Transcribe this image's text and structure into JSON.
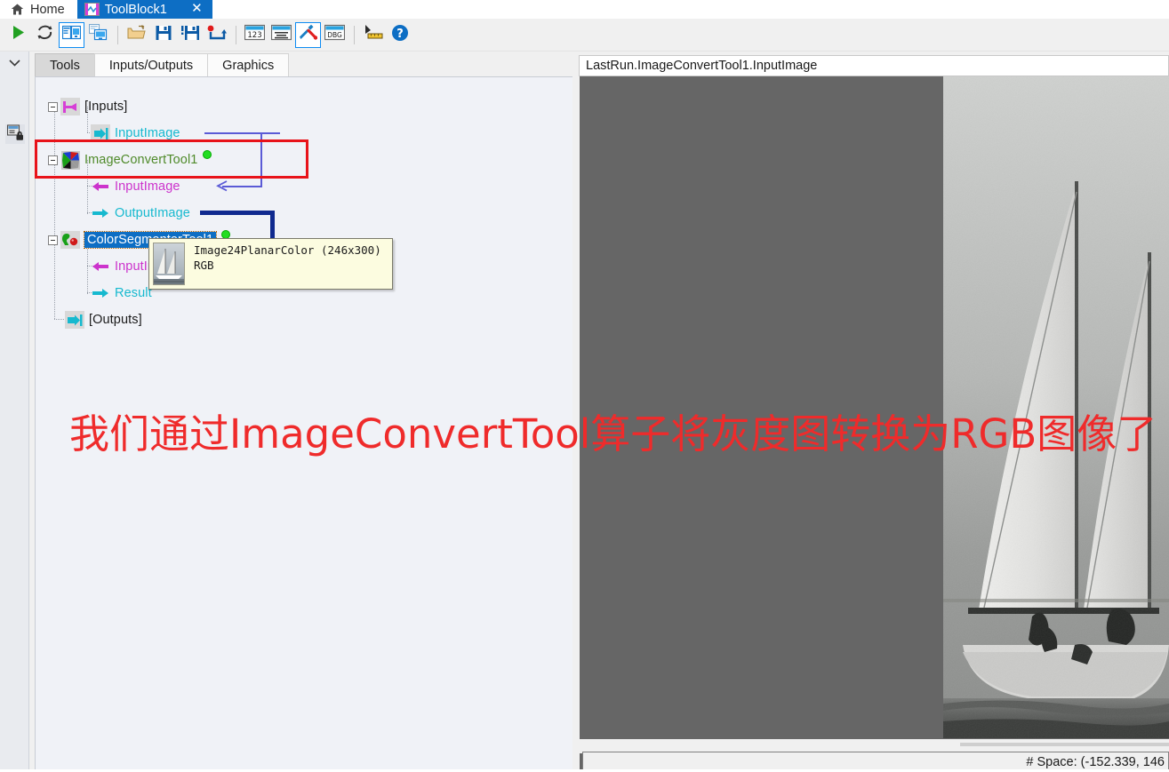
{
  "window": {
    "home_tab_label": "Home",
    "home_icon": "home-icon",
    "document_tab_label": "ToolBlock1",
    "document_tab_icon": "toolblock-icon",
    "close_label": "✕"
  },
  "toolbar": {
    "buttons": [
      {
        "name": "run-button",
        "icon": "play-triangle-icon",
        "label": "Run",
        "active": false
      },
      {
        "name": "run-continuous-button",
        "icon": "loop-arrows-icon",
        "label": "Run Continuous",
        "active": false
      },
      {
        "name": "show-tool-panel-button",
        "icon": "dual-pane-icon",
        "label": "Show Tool Panel",
        "active": true
      },
      {
        "name": "show-result-panel-button",
        "icon": "stacked-pane-icon",
        "label": "Show Result Panel",
        "active": false
      },
      {
        "name": "open-button",
        "icon": "open-folder-icon",
        "label": "Open",
        "active": false
      },
      {
        "name": "save-button",
        "icon": "floppy-save-icon",
        "label": "Save",
        "active": false
      },
      {
        "name": "save-as-button",
        "icon": "floppy-save-as-icon",
        "label": "Save As",
        "active": false
      },
      {
        "name": "record-restore-button",
        "icon": "red-dot-arrow-icon",
        "label": "Restore",
        "active": false
      },
      {
        "name": "show-values-button",
        "icon": "numbers-123-icon",
        "label": "Show Values",
        "active": false
      },
      {
        "name": "show-details-button",
        "icon": "list-lines-icon",
        "label": "Show Details",
        "active": false
      },
      {
        "name": "tools-settings-button",
        "icon": "wrench-screwdriver-icon",
        "label": "Tools",
        "active": true
      },
      {
        "name": "debug-button",
        "icon": "dbg-icon",
        "label": "DBG",
        "active": false
      },
      {
        "name": "measure-button",
        "icon": "ruler-cursor-icon",
        "label": "Measure",
        "active": false
      },
      {
        "name": "help-button",
        "icon": "question-circle-icon",
        "label": "Help",
        "active": false
      }
    ]
  },
  "leftrail": {
    "collapse_icon": "chevron-down-icon",
    "lock_icon": "locked-panel-icon"
  },
  "panel_tabs": [
    {
      "name": "tab-tools",
      "label": "Tools",
      "selected": true
    },
    {
      "name": "tab-inputs-outputs",
      "label": "Inputs/Outputs",
      "selected": false
    },
    {
      "name": "tab-graphics",
      "label": "Graphics",
      "selected": false
    }
  ],
  "tree": {
    "nodes": [
      {
        "name": "tree-node-inputs",
        "label": "[Inputs]",
        "icon": "inputs-arrow-icon",
        "color": "black",
        "indent": 0,
        "toggle": true,
        "dot": false,
        "selected": false
      },
      {
        "name": "tree-node-inputimage-root",
        "label": "InputImage",
        "icon": "input-terminal-icon",
        "color": "cyan",
        "indent": 1,
        "toggle": false,
        "dot": false,
        "selected": false
      },
      {
        "name": "tree-node-imageconverttool1",
        "label": "ImageConvertTool1",
        "icon": "image-convert-tool-icon",
        "color": "green",
        "indent": 0,
        "toggle": true,
        "dot": true,
        "selected": false
      },
      {
        "name": "tree-node-ict-inputimage",
        "label": "InputImage",
        "icon": "input-arrow-icon",
        "color": "magenta",
        "indent": 1,
        "toggle": false,
        "dot": false,
        "selected": false
      },
      {
        "name": "tree-node-ict-outputimage",
        "label": "OutputImage",
        "icon": "output-arrow-icon",
        "color": "cyan",
        "indent": 1,
        "toggle": false,
        "dot": false,
        "selected": false
      },
      {
        "name": "tree-node-colorsegmenttool1",
        "label": "ColorSegmenterTool1",
        "icon": "color-segmenter-icon",
        "color": "black",
        "indent": 0,
        "toggle": true,
        "dot": true,
        "selected": true
      },
      {
        "name": "tree-node-cs-inputimage",
        "label": "InputImage",
        "icon": "input-arrow-icon",
        "color": "magenta",
        "indent": 1,
        "toggle": false,
        "dot": false,
        "selected": false
      },
      {
        "name": "tree-node-cs-result",
        "label": "Result",
        "icon": "output-arrow-icon",
        "color": "cyan",
        "indent": 1,
        "toggle": false,
        "dot": false,
        "selected": false
      },
      {
        "name": "tree-node-outputs",
        "label": "[Outputs]",
        "icon": "outputs-arrow-icon",
        "color": "black",
        "indent": 0,
        "toggle": false,
        "dot": false,
        "selected": false
      }
    ]
  },
  "tooltip": {
    "line1": "Image24PlanarColor (246x300)",
    "line2": "RGB",
    "thumbnail": "sailboat-thumbnail"
  },
  "annotation": {
    "text": "我们通过ImageConvertTool算子将灰度图转换为RGB图像了",
    "color": "#ef2b2b",
    "highlight_box_color": "#e8131a"
  },
  "image_panel": {
    "header_title": "LastRun.ImageConvertTool1.InputImage",
    "canvas_background": "#666666",
    "photo_name": "sailboat-grayscale-image"
  },
  "status_bar": {
    "text": "# Space: (-152.339, 146"
  }
}
